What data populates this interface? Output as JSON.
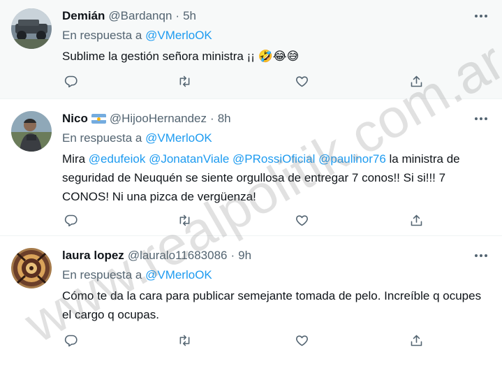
{
  "tweets": [
    {
      "name": "Demián",
      "handle": "@Bardanqn",
      "separator": "·",
      "time": "5h",
      "reply_prefix": "En respuesta a",
      "reply_to": "@VMerloOK",
      "body_text": "Sublime la gestión señora ministra ¡¡ ",
      "emojis": "🤣😂😅"
    },
    {
      "name": "Nico",
      "handle": "@HijooHernandez",
      "separator": "·",
      "time": "8h",
      "reply_prefix": "En respuesta a",
      "reply_to": "@VMerloOK",
      "body_prefix": "Mira",
      "mentions": [
        "@edufeiok",
        "@JonatanViale",
        "@PRossiOficial",
        "@paulinor76"
      ],
      "body_rest": "la ministra de seguridad de Neuquén se siente orgullosa de entregar 7 conos!! Si si!!! 7 CONOS! Ni una pizca de vergüenza!"
    },
    {
      "name": "laura lopez",
      "handle": "@lauralo11683086",
      "separator": "·",
      "time": "9h",
      "reply_prefix": "En respuesta a",
      "reply_to": "@VMerloOK",
      "body_text": "Cómo te da la cara para publicar semejante tomada de pelo. Increíble q ocupes el cargo q ocupas."
    }
  ],
  "watermark": "www.realpolitik.com.ar",
  "icons": {
    "reply": "reply-icon",
    "retweet": "retweet-icon",
    "like": "heart-icon",
    "share": "share-icon",
    "more": "more-icon"
  },
  "colors": {
    "link": "#1d9bf0",
    "secondary_text": "#536471",
    "primary_text": "#0f1419"
  }
}
